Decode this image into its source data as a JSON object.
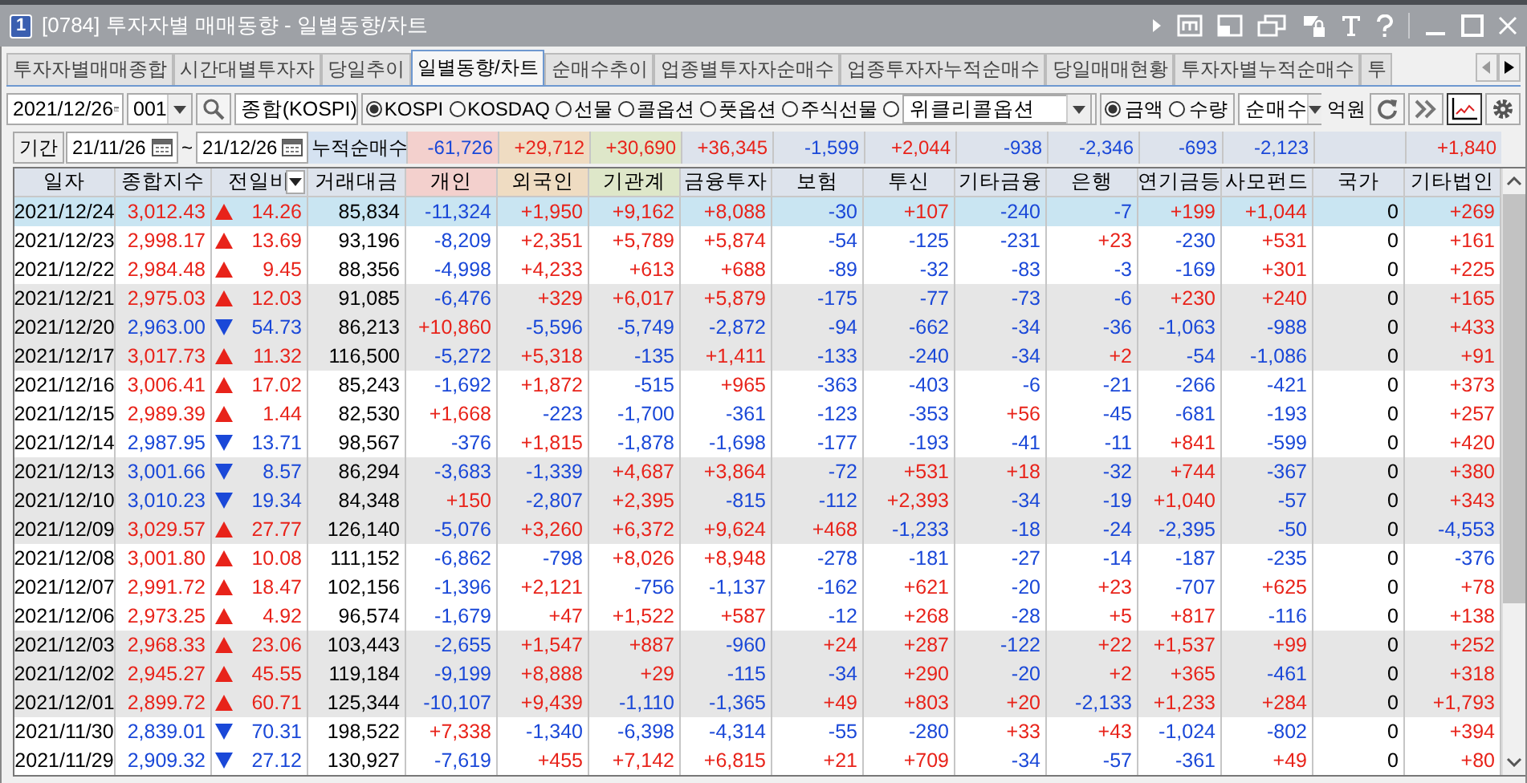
{
  "window": {
    "badge": "1",
    "title": "[0784] 투자자별 매매동향 - 일별동향/차트"
  },
  "tabs": [
    {
      "label": "투자자별매매종합",
      "selected": false
    },
    {
      "label": "시간대별투자자",
      "selected": false
    },
    {
      "label": "당일추이",
      "selected": false
    },
    {
      "label": "일별동향/차트",
      "selected": true
    },
    {
      "label": "순매수추이",
      "selected": false
    },
    {
      "label": "업종별투자자순매수",
      "selected": false
    },
    {
      "label": "업종투자자누적순매수",
      "selected": false
    },
    {
      "label": "당일매매현황",
      "selected": false
    },
    {
      "label": "투자자별누적순매수",
      "selected": false
    },
    {
      "label": "투",
      "selected": false
    }
  ],
  "toolbar": {
    "date": "2021/12/26",
    "code": "001",
    "market_name": "종합(KOSPI)",
    "markets": [
      {
        "label": "KOSPI",
        "selected": true,
        "kind": "radio"
      },
      {
        "label": "KOSDAQ",
        "selected": false,
        "kind": "radio"
      },
      {
        "label": "선물",
        "selected": false,
        "kind": "radio"
      },
      {
        "label": "콜옵션",
        "selected": false,
        "kind": "radio"
      },
      {
        "label": "풋옵션",
        "selected": false,
        "kind": "radio"
      },
      {
        "label": "주식선물",
        "selected": false,
        "kind": "radio"
      },
      {
        "label": "위클리콜옵션",
        "selected": false,
        "kind": "dropdown"
      }
    ],
    "units": [
      {
        "label": "금액",
        "selected": true
      },
      {
        "label": "수량",
        "selected": false
      }
    ],
    "measure": "순매수",
    "unit_label": "억원"
  },
  "period": {
    "label": "기간",
    "from": "21/11/26",
    "separator": "~",
    "to": "21/12/26",
    "total_label": "누적순매수",
    "totals": [
      {
        "kind": "value",
        "value": "-61,726"
      },
      {
        "kind": "value",
        "value": "+29,712"
      },
      {
        "kind": "value",
        "value": "+30,690"
      },
      {
        "kind": "value",
        "value": "+36,345"
      },
      {
        "kind": "value",
        "value": "-1,599"
      },
      {
        "kind": "value",
        "value": "+2,044"
      },
      {
        "kind": "value",
        "value": "-938"
      },
      {
        "kind": "value",
        "value": "-2,346"
      },
      {
        "kind": "value",
        "value": "-693"
      },
      {
        "kind": "value",
        "value": "-2,123"
      },
      {
        "kind": "blank"
      },
      {
        "kind": "value",
        "value": "+1,840"
      }
    ]
  },
  "table": {
    "columns": [
      {
        "label": "일자",
        "menu": false,
        "color": "#dde3ec"
      },
      {
        "label": "종합지수",
        "menu": false,
        "color": "#dde3ec"
      },
      {
        "label": "전일비",
        "menu": true,
        "color": "#dde3ec"
      },
      {
        "label": "거래대금",
        "menu": false,
        "color": "#dde3ec"
      },
      {
        "label": "개인",
        "menu": false,
        "color": "#f3d0cd"
      },
      {
        "label": "외국인",
        "menu": false,
        "color": "#efdcc2"
      },
      {
        "label": "기관계",
        "menu": false,
        "color": "#dee7c9"
      },
      {
        "label": "금융투자",
        "menu": false,
        "color": "#dde3ec"
      },
      {
        "label": "보험",
        "menu": false,
        "color": "#dde3ec"
      },
      {
        "label": "투신",
        "menu": false,
        "color": "#dde3ec"
      },
      {
        "label": "기타금융",
        "menu": false,
        "color": "#dde3ec"
      },
      {
        "label": "은행",
        "menu": false,
        "color": "#dde3ec"
      },
      {
        "label": "연기금등",
        "menu": false,
        "color": "#dde3ec"
      },
      {
        "label": "사모펀드",
        "menu": false,
        "color": "#dde3ec"
      },
      {
        "label": "국가",
        "menu": false,
        "color": "#dde3ec"
      },
      {
        "label": "기타법인",
        "menu": false,
        "color": "#dde3ec"
      }
    ],
    "rows": [
      {
        "selected": true,
        "rising": true,
        "cells": [
          "2021/12/24",
          "3,012.43",
          "14.26",
          "85,834",
          "-11,324",
          "+1,950",
          "+9,162",
          "+8,088",
          "-30",
          "+107",
          "-240",
          "-7",
          "+199",
          "+1,044",
          "0",
          "+269"
        ]
      },
      {
        "selected": false,
        "rising": true,
        "cells": [
          "2021/12/23",
          "2,998.17",
          "13.69",
          "93,196",
          "-8,209",
          "+2,351",
          "+5,789",
          "+5,874",
          "-54",
          "-125",
          "-231",
          "+23",
          "-230",
          "+531",
          "0",
          "+161"
        ]
      },
      {
        "selected": false,
        "rising": true,
        "cells": [
          "2021/12/22",
          "2,984.48",
          "9.45",
          "88,356",
          "-4,998",
          "+4,233",
          "+613",
          "+688",
          "-89",
          "-32",
          "-83",
          "-3",
          "-169",
          "+301",
          "0",
          "+225"
        ]
      },
      {
        "selected": false,
        "rising": true,
        "cells": [
          "2021/12/21",
          "2,975.03",
          "12.03",
          "91,085",
          "-6,476",
          "+329",
          "+6,017",
          "+5,879",
          "-175",
          "-77",
          "-73",
          "-6",
          "+230",
          "+240",
          "0",
          "+165"
        ]
      },
      {
        "selected": false,
        "rising": false,
        "cells": [
          "2021/12/20",
          "2,963.00",
          "54.73",
          "86,213",
          "+10,860",
          "-5,596",
          "-5,749",
          "-2,872",
          "-94",
          "-662",
          "-34",
          "-36",
          "-1,063",
          "-988",
          "0",
          "+433"
        ]
      },
      {
        "selected": false,
        "rising": true,
        "cells": [
          "2021/12/17",
          "3,017.73",
          "11.32",
          "116,500",
          "-5,272",
          "+5,318",
          "-135",
          "+1,411",
          "-133",
          "-240",
          "-34",
          "+2",
          "-54",
          "-1,086",
          "0",
          "+91"
        ]
      },
      {
        "selected": false,
        "rising": true,
        "cells": [
          "2021/12/16",
          "3,006.41",
          "17.02",
          "85,243",
          "-1,692",
          "+1,872",
          "-515",
          "+965",
          "-363",
          "-403",
          "-6",
          "-21",
          "-266",
          "-421",
          "0",
          "+373"
        ]
      },
      {
        "selected": false,
        "rising": true,
        "cells": [
          "2021/12/15",
          "2,989.39",
          "1.44",
          "82,530",
          "+1,668",
          "-223",
          "-1,700",
          "-361",
          "-123",
          "-353",
          "+56",
          "-45",
          "-681",
          "-193",
          "0",
          "+257"
        ]
      },
      {
        "selected": false,
        "rising": false,
        "cells": [
          "2021/12/14",
          "2,987.95",
          "13.71",
          "98,567",
          "-376",
          "+1,815",
          "-1,878",
          "-1,698",
          "-177",
          "-193",
          "-41",
          "-11",
          "+841",
          "-599",
          "0",
          "+420"
        ]
      },
      {
        "selected": false,
        "rising": false,
        "cells": [
          "2021/12/13",
          "3,001.66",
          "8.57",
          "86,294",
          "-3,683",
          "-1,339",
          "+4,687",
          "+3,864",
          "-72",
          "+531",
          "+18",
          "-32",
          "+744",
          "-367",
          "0",
          "+380"
        ]
      },
      {
        "selected": false,
        "rising": false,
        "cells": [
          "2021/12/10",
          "3,010.23",
          "19.34",
          "84,348",
          "+150",
          "-2,807",
          "+2,395",
          "-815",
          "-112",
          "+2,393",
          "-34",
          "-19",
          "+1,040",
          "-57",
          "0",
          "+343"
        ]
      },
      {
        "selected": false,
        "rising": true,
        "cells": [
          "2021/12/09",
          "3,029.57",
          "27.77",
          "126,140",
          "-5,076",
          "+3,260",
          "+6,372",
          "+9,624",
          "+468",
          "-1,233",
          "-18",
          "-24",
          "-2,395",
          "-50",
          "0",
          "-4,553"
        ]
      },
      {
        "selected": false,
        "rising": true,
        "cells": [
          "2021/12/08",
          "3,001.80",
          "10.08",
          "111,152",
          "-6,862",
          "-798",
          "+8,026",
          "+8,948",
          "-278",
          "-181",
          "-27",
          "-14",
          "-187",
          "-235",
          "0",
          "-376"
        ]
      },
      {
        "selected": false,
        "rising": true,
        "cells": [
          "2021/12/07",
          "2,991.72",
          "18.47",
          "102,156",
          "-1,396",
          "+2,121",
          "-756",
          "-1,137",
          "-162",
          "+621",
          "-20",
          "+23",
          "-707",
          "+625",
          "0",
          "+78"
        ]
      },
      {
        "selected": false,
        "rising": true,
        "cells": [
          "2021/12/06",
          "2,973.25",
          "4.92",
          "96,574",
          "-1,679",
          "+47",
          "+1,522",
          "+587",
          "-12",
          "+268",
          "-28",
          "+5",
          "+817",
          "-116",
          "0",
          "+138"
        ]
      },
      {
        "selected": false,
        "rising": true,
        "cells": [
          "2021/12/03",
          "2,968.33",
          "23.06",
          "103,443",
          "-2,655",
          "+1,547",
          "+887",
          "-960",
          "+24",
          "+287",
          "-122",
          "+22",
          "+1,537",
          "+99",
          "0",
          "+252"
        ]
      },
      {
        "selected": false,
        "rising": true,
        "cells": [
          "2021/12/02",
          "2,945.27",
          "45.55",
          "119,184",
          "-9,199",
          "+8,888",
          "+29",
          "-115",
          "-34",
          "+290",
          "-20",
          "+2",
          "+365",
          "-461",
          "0",
          "+318"
        ]
      },
      {
        "selected": false,
        "rising": true,
        "cells": [
          "2021/12/01",
          "2,899.72",
          "60.71",
          "125,344",
          "-10,107",
          "+9,439",
          "-1,110",
          "-1,365",
          "+49",
          "+803",
          "+20",
          "-2,133",
          "+1,233",
          "+284",
          "0",
          "+1,793"
        ]
      },
      {
        "selected": false,
        "rising": false,
        "cells": [
          "2021/11/30",
          "2,839.01",
          "70.31",
          "198,522",
          "+7,338",
          "-1,340",
          "-6,398",
          "-4,314",
          "-55",
          "-280",
          "+33",
          "+43",
          "-1,024",
          "-802",
          "0",
          "+394"
        ]
      },
      {
        "selected": false,
        "rising": false,
        "cells": [
          "2021/11/29",
          "2,909.32",
          "27.12",
          "130,927",
          "-7,619",
          "+455",
          "+7,142",
          "+6,815",
          "+21",
          "+709",
          "-34",
          "-57",
          "-361",
          "+49",
          "0",
          "+80"
        ]
      }
    ]
  }
}
